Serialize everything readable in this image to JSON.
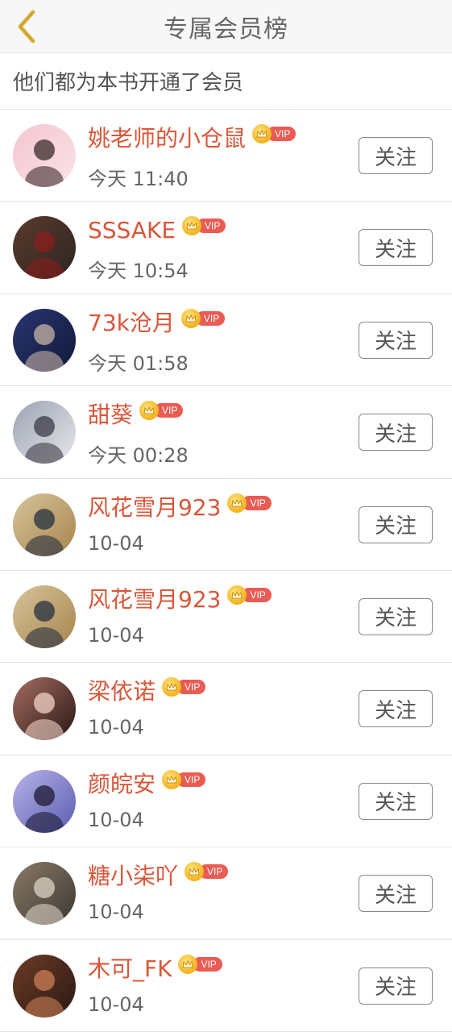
{
  "header": {
    "title": "专属会员榜"
  },
  "subheader": {
    "text": "他们都为本书开通了会员"
  },
  "vip_label": "VIP",
  "follow_label": "关注",
  "members": [
    {
      "name": "姚老师的小仓鼠",
      "time": "今天 11:40",
      "avatar_colors": [
        "#fbe3e8",
        "#f3c5cf",
        "#3a2a2a"
      ]
    },
    {
      "name": "SSSAKE",
      "time": "今天 10:54",
      "avatar_colors": [
        "#2c2622",
        "#5a3a2c",
        "#8b1d1d"
      ]
    },
    {
      "name": "73k沧月",
      "time": "今天 01:58",
      "avatar_colors": [
        "#0f1a3a",
        "#2a3570",
        "#c8b3a6"
      ]
    },
    {
      "name": "甜葵",
      "time": "今天 00:28",
      "avatar_colors": [
        "#e9e6ea",
        "#9aa4b3",
        "#3c3b45"
      ]
    },
    {
      "name": "风花雪月923",
      "time": "10-04",
      "avatar_colors": [
        "#a7844c",
        "#d6c49a",
        "#263041"
      ]
    },
    {
      "name": "风花雪月923",
      "time": "10-04",
      "avatar_colors": [
        "#a7844c",
        "#d6c49a",
        "#263041"
      ]
    },
    {
      "name": "梁依诺",
      "time": "10-04",
      "avatar_colors": [
        "#2a1614",
        "#a56e62",
        "#f0d2c5"
      ]
    },
    {
      "name": "颜皖安",
      "time": "10-04",
      "avatar_colors": [
        "#5a5db0",
        "#b7b2e8",
        "#1d1a33"
      ]
    },
    {
      "name": "糖小柒吖",
      "time": "10-04",
      "avatar_colors": [
        "#3c3833",
        "#8a7a66",
        "#dcd3c4"
      ]
    },
    {
      "name": "木可_FK",
      "time": "10-04",
      "avatar_colors": [
        "#2b1a14",
        "#6b3b25",
        "#c97d55"
      ]
    }
  ],
  "colors": {
    "name": "#d9573a",
    "vip_pill": "#e95c54",
    "back_chevron": "#e0b13a"
  }
}
